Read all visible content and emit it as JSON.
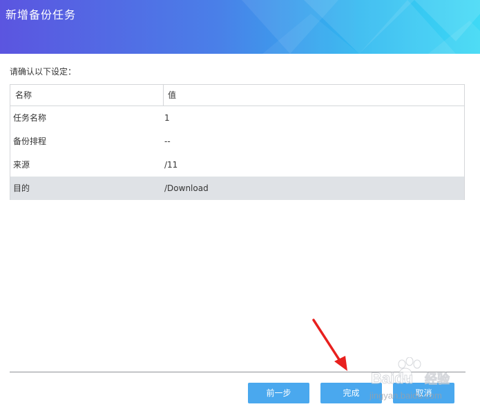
{
  "dialog": {
    "title": "新增备份任务",
    "prompt": "请确认以下设定："
  },
  "table": {
    "columns": [
      "名称",
      "值"
    ],
    "rows": [
      {
        "name": "任务名称",
        "value": "1",
        "selected": false
      },
      {
        "name": "备份排程",
        "value": "--",
        "selected": false
      },
      {
        "name": "来源",
        "value": "/11",
        "selected": false
      },
      {
        "name": "目的",
        "value": "/Download",
        "selected": true
      }
    ]
  },
  "buttons": {
    "prev": "前一步",
    "finish": "完成",
    "cancel": "取消"
  },
  "watermark": {
    "brand": "Baidu",
    "brand_cn": "经验",
    "url": "jingyan.baidu.com"
  },
  "colors": {
    "header_gradient_start": "#5b55e0",
    "header_gradient_end": "#3fd9f5",
    "button": "#4aa8ee",
    "selected_row": "#dfe2e6",
    "annotation_arrow": "#e8201e"
  },
  "icons": {
    "annotation": "red-arrow-icon",
    "watermark": "baidu-paw-icon"
  }
}
